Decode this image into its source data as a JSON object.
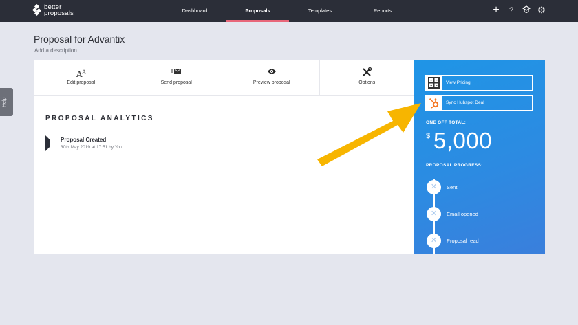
{
  "app": {
    "logo_line1": "better",
    "logo_line2": "proposals"
  },
  "nav": {
    "items": [
      {
        "label": "Dashboard"
      },
      {
        "label": "Proposals"
      },
      {
        "label": "Templates"
      },
      {
        "label": "Reports"
      }
    ],
    "active": "Proposals",
    "icons": [
      "plus-icon",
      "help-icon",
      "graduation-cap-icon",
      "gear-icon"
    ],
    "icon_glyphs": [
      "+",
      "?",
      "⌂",
      "⚙"
    ]
  },
  "help_tab": {
    "label": "Help"
  },
  "page": {
    "title": "Proposal for Advantix",
    "description": "Add a description"
  },
  "toolbar": {
    "items": [
      {
        "label": "Edit proposal",
        "icon": "font-size-icon",
        "glyph": "Aᴬ"
      },
      {
        "label": "Send proposal",
        "icon": "send-envelope-icon",
        "glyph": "✉"
      },
      {
        "label": "Preview proposal",
        "icon": "eye-icon",
        "glyph": "👁"
      },
      {
        "label": "Options",
        "icon": "tools-icon",
        "glyph": "✕"
      }
    ]
  },
  "analytics": {
    "title": "PROPOSAL ANALYTICS",
    "events": [
      {
        "title": "Proposal Created",
        "detail": "30th May 2019 at 17:51 by You"
      }
    ]
  },
  "side_panel": {
    "buttons": [
      {
        "label": "View Pricing",
        "icon": "calculator-icon"
      },
      {
        "label": "Sync Hubspot Deal",
        "icon": "hubspot-icon"
      }
    ],
    "total_label": "ONE OFF TOTAL:",
    "currency": "$",
    "total_amount": "5,000",
    "progress_label": "PROPOSAL PROGRESS:",
    "progress_steps": [
      {
        "label": "Sent",
        "status": "incomplete"
      },
      {
        "label": "Email opened",
        "status": "incomplete"
      },
      {
        "label": "Proposal read",
        "status": "incomplete"
      }
    ]
  },
  "colors": {
    "nav_bg": "#2b2e38",
    "nav_active": "#e8677a",
    "panel_blue": "#2c8be2",
    "arrow": "#f7b500",
    "hubspot": "#f57722"
  }
}
